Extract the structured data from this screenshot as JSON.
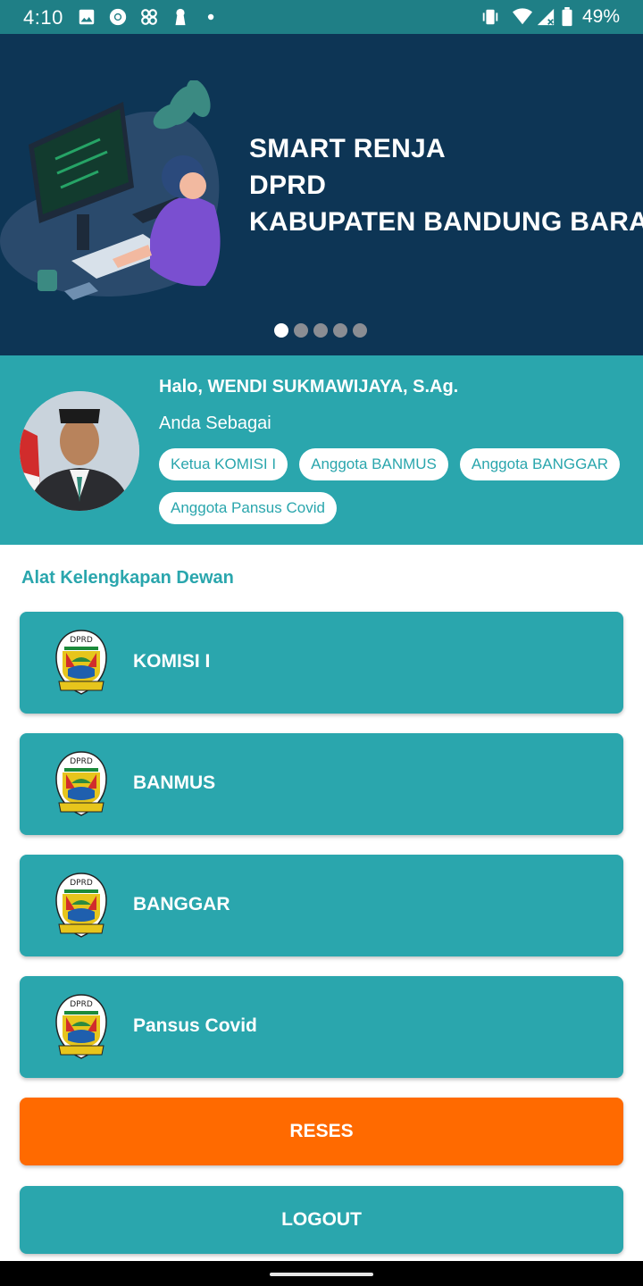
{
  "status_bar": {
    "time": "4:10",
    "battery": "49%",
    "icons": [
      "image-icon",
      "chrome-icon",
      "fan-icon",
      "keyhole-icon",
      "dot-icon",
      "vibrate-icon",
      "wifi-icon",
      "signal-icon",
      "battery-icon"
    ]
  },
  "banner": {
    "title_lines": [
      "SMART RENJA",
      "DPRD",
      "KABUPATEN BANDUNG BARAT"
    ],
    "slide_count": 5,
    "active_slide": 1
  },
  "profile": {
    "greeting": "Halo, WENDI SUKMAWIJAYA, S.Ag.",
    "role_label": "Anda Sebagai",
    "roles": [
      "Ketua KOMISI I",
      "Anggota BANMUS",
      "Anggota BANGGAR",
      "Anggota Pansus Covid"
    ]
  },
  "section": {
    "title": "Alat Kelengkapan Dewan"
  },
  "cards": [
    {
      "label": "KOMISI I"
    },
    {
      "label": "BANMUS"
    },
    {
      "label": "BANGGAR"
    },
    {
      "label": "Pansus Covid"
    }
  ],
  "buttons": {
    "reses": "RESES",
    "logout": "LOGOUT"
  },
  "colors": {
    "primary": "#2aa6ad",
    "status_bar": "#1f7f86",
    "banner_bg": "#0d3555",
    "accent_orange": "#ff6a00"
  }
}
